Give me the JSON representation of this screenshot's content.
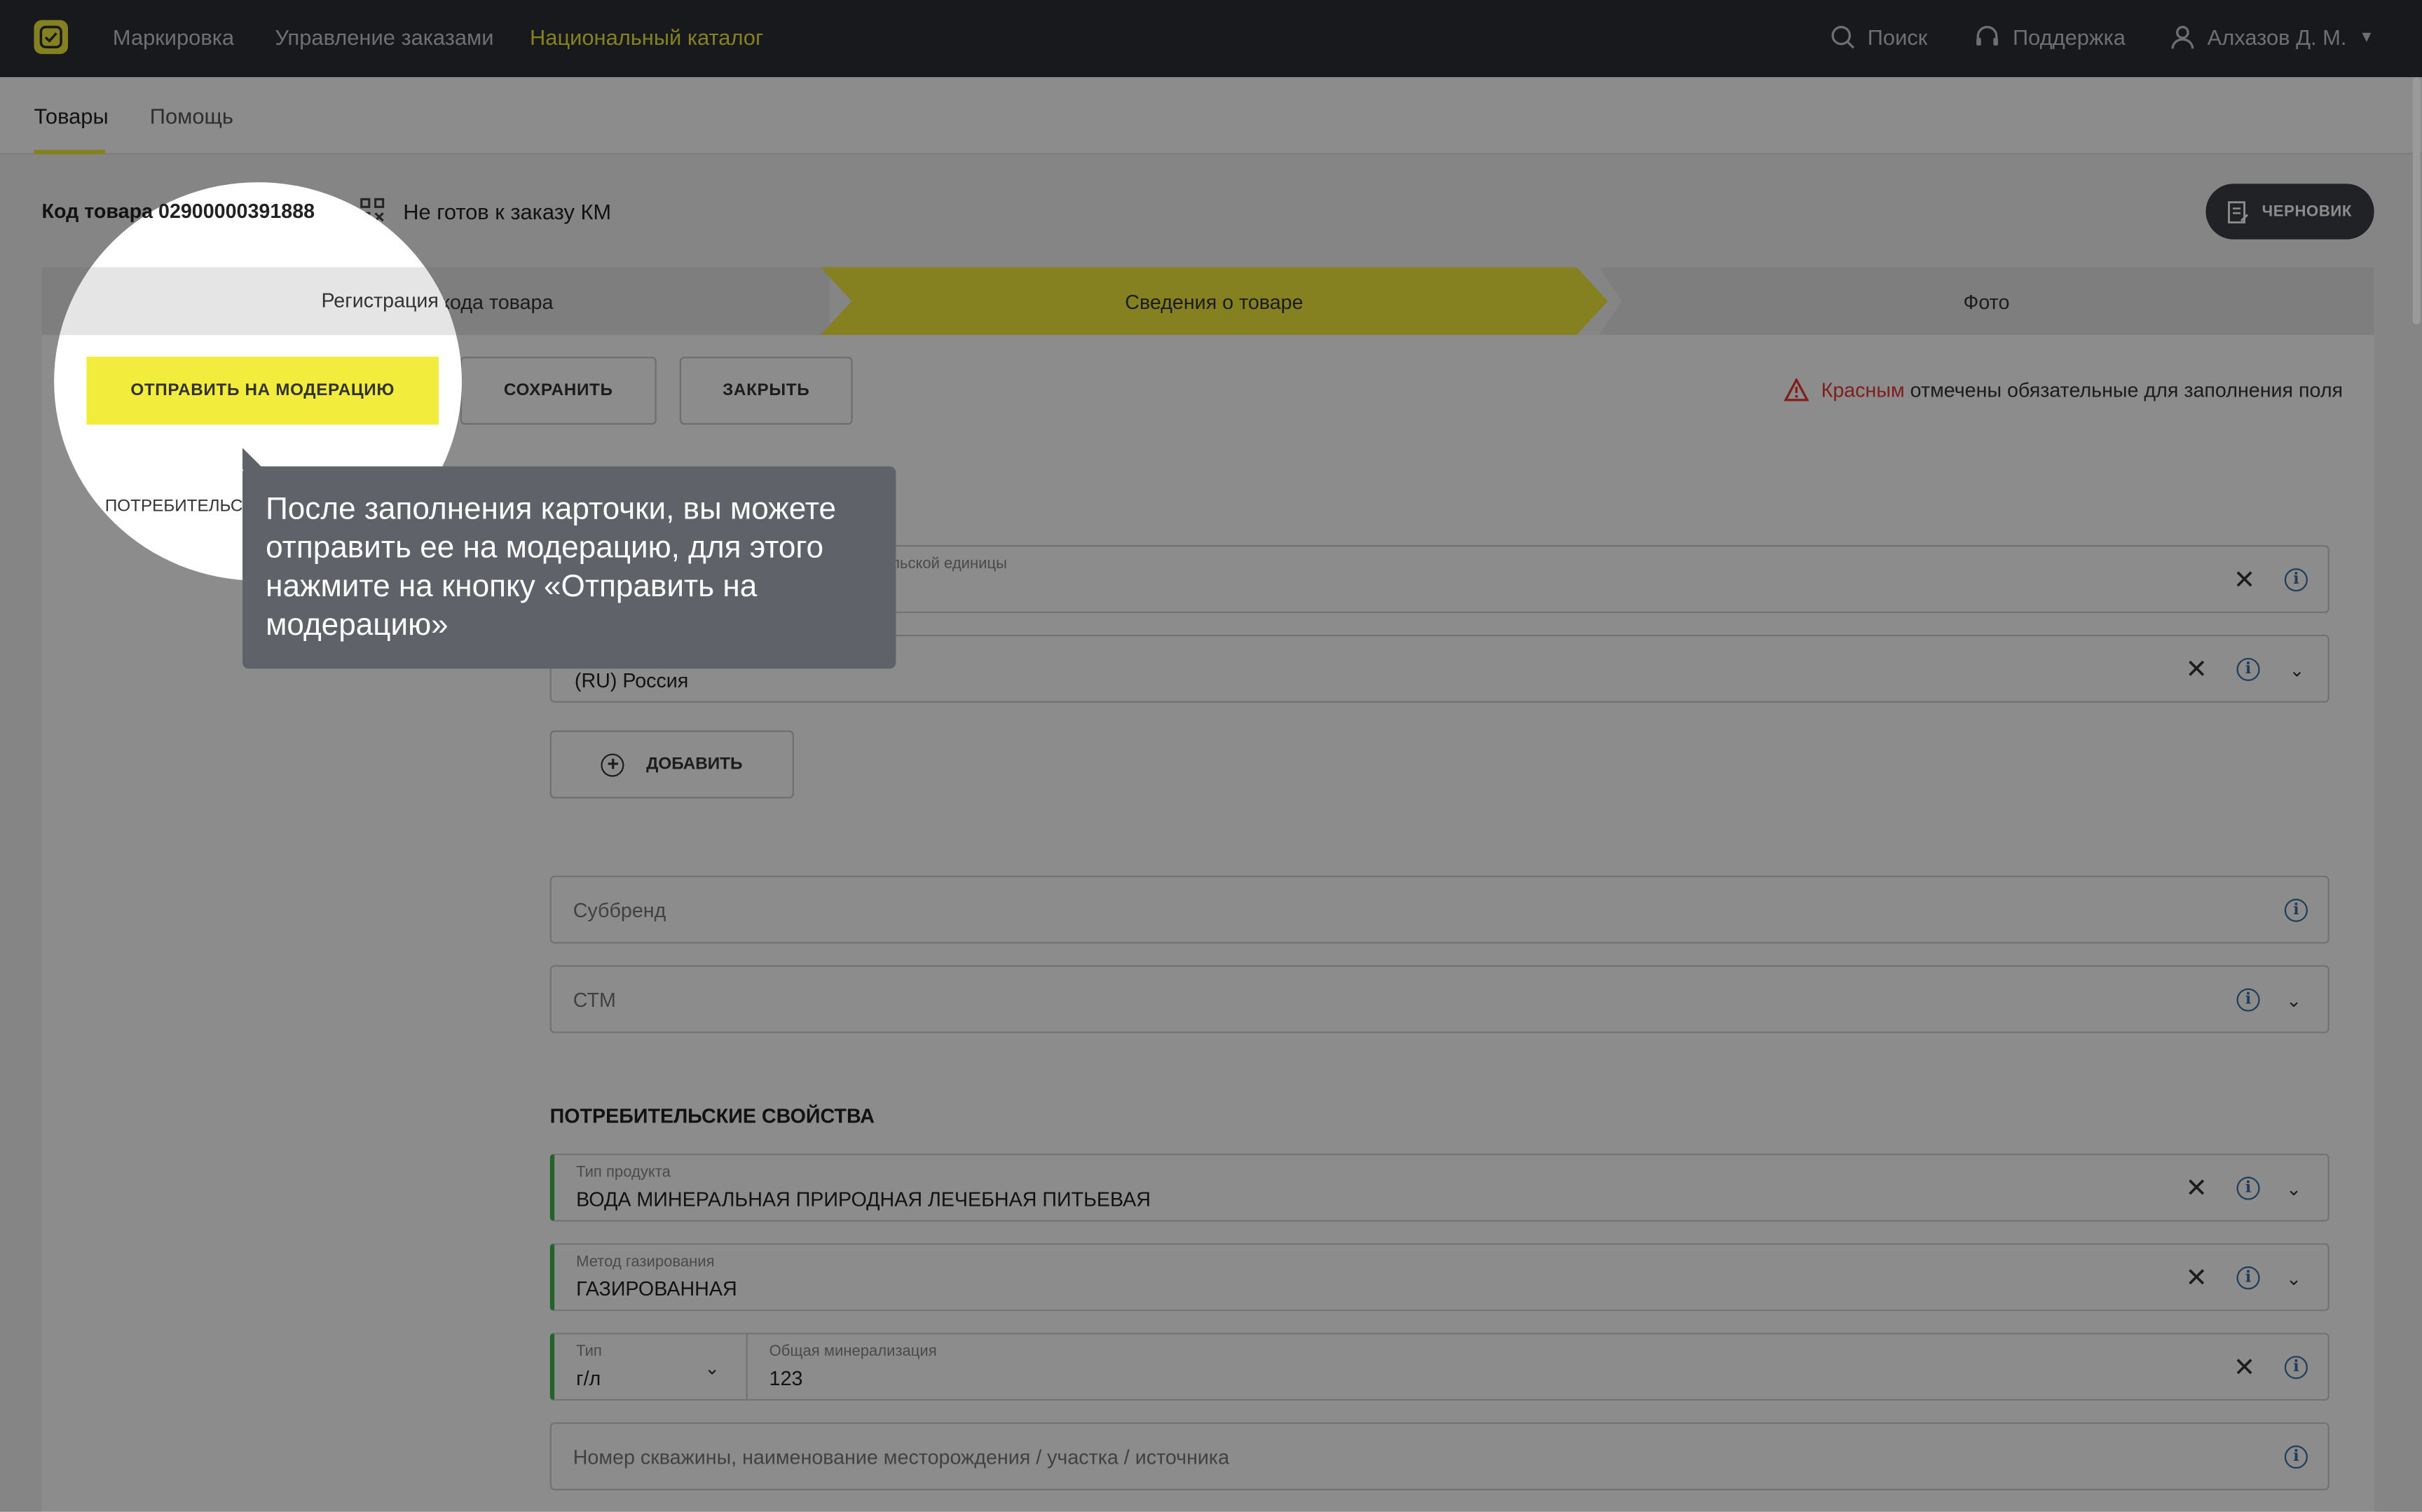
{
  "nav": {
    "items": [
      "Маркировка",
      "Управление заказами",
      "Национальный каталог"
    ],
    "search": "Поиск",
    "support": "Поддержка",
    "user": "Алхазов Д. М."
  },
  "subnav": {
    "tabs": [
      "Товары",
      "Помощь"
    ]
  },
  "product": {
    "code_label": "Код товара 02900000391888",
    "status": "Не готов к заказу КМ",
    "draft": "ЧЕРНОВИК"
  },
  "steps": [
    "Регистрация кода товара",
    "Сведения о товаре",
    "Фото"
  ],
  "actions": {
    "send": "ОТПРАВИТЬ НА МОДЕРАЦИЮ",
    "save": "СОХРАНИТЬ",
    "close": "ЗАКРЫТЬ"
  },
  "required_note": {
    "red": "Красным",
    "rest": "отмечены обязательные для заполнения поля"
  },
  "side_label": "ПОТРЕБИТЕЛЬС",
  "fields": {
    "unit_label": "тельской единицы",
    "country_value": "(RU) Россия",
    "add_button": "ДОБАВИТЬ",
    "subbrand_placeholder": "Суббренд",
    "stm_placeholder": "СТМ"
  },
  "consumer": {
    "title": "ПОТРЕБИТЕЛЬСКИЕ СВОЙСТВА",
    "product_type_label": "Тип продукта",
    "product_type_value": "ВОДА МИНЕРАЛЬНАЯ ПРИРОДНАЯ ЛЕЧЕБНАЯ ПИТЬЕВАЯ",
    "gas_label": "Метод газирования",
    "gas_value": "ГАЗИРОВАННАЯ",
    "type_label": "Тип",
    "type_value": "г/л",
    "mineral_label": "Общая минерализация",
    "mineral_value": "123",
    "well_placeholder": "Номер скважины, наименование месторождения / участка / источника"
  },
  "tooltip": {
    "text": "После заполнения карточки, вы можете отправить ее на модерацию, для этого нажмите на кнопку «Отправить на модерацию»"
  }
}
